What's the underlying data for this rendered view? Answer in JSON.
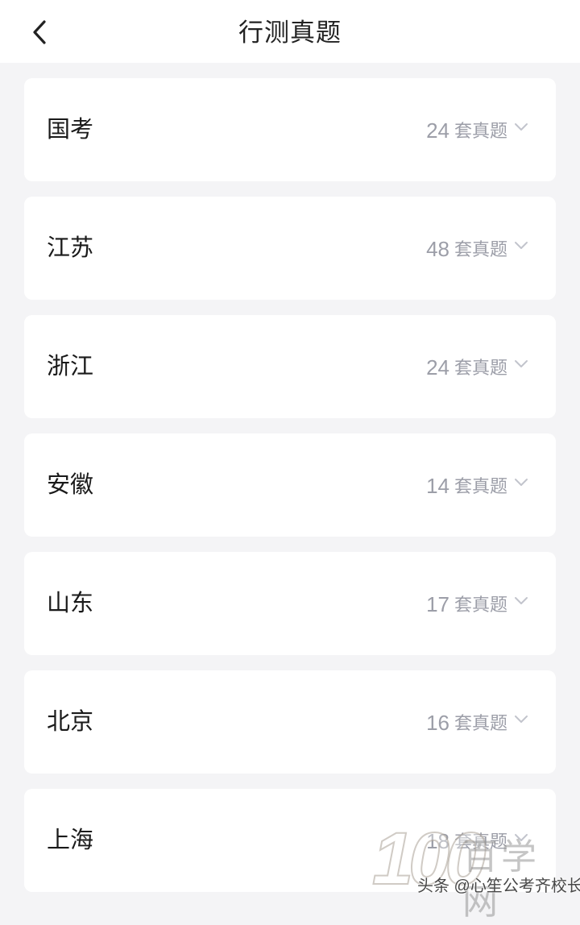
{
  "header": {
    "title": "行测真题",
    "back_icon": "chevron-left-icon"
  },
  "colors": {
    "background": "#f4f4f6",
    "card": "#ffffff",
    "label": "#1a1a1a",
    "meta": "#9c9ea8"
  },
  "items": [
    {
      "label": "国考",
      "count": "24",
      "unit": "套真题",
      "icon": "chevron-down-icon"
    },
    {
      "label": "江苏",
      "count": "48",
      "unit": "套真题",
      "icon": "chevron-down-icon"
    },
    {
      "label": "浙江",
      "count": "24",
      "unit": "套真题",
      "icon": "chevron-down-icon"
    },
    {
      "label": "安徽",
      "count": "14",
      "unit": "套真题",
      "icon": "chevron-down-icon"
    },
    {
      "label": "山东",
      "count": "17",
      "unit": "套真题",
      "icon": "chevron-down-icon"
    },
    {
      "label": "北京",
      "count": "16",
      "unit": "套真题",
      "icon": "chevron-down-icon"
    },
    {
      "label": "上海",
      "count": "18",
      "unit": "套真题",
      "icon": "chevron-down-icon"
    }
  ],
  "watermark": {
    "logo_number": "100",
    "logo_text": "百学网",
    "credit": "头条 @心笙公考齐校长"
  }
}
